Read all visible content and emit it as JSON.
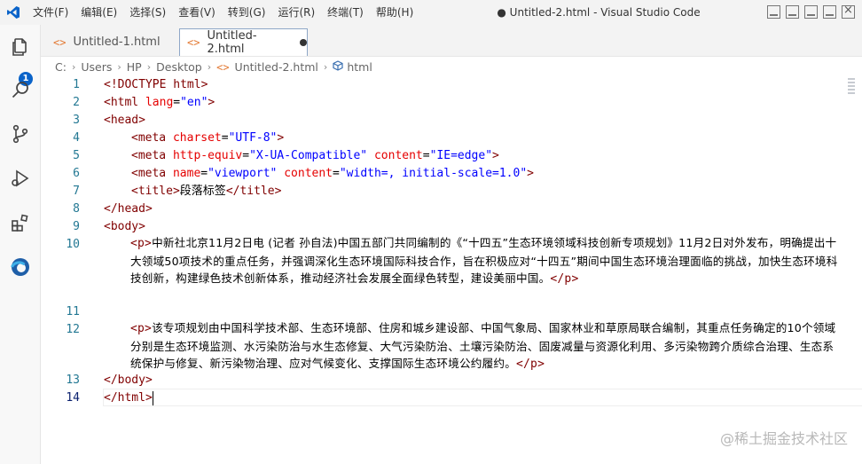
{
  "menu": [
    "文件(F)",
    "编辑(E)",
    "选择(S)",
    "查看(V)",
    "转到(G)",
    "运行(R)",
    "终端(T)",
    "帮助(H)"
  ],
  "window_title": "● Untitled-2.html - Visual Studio Code",
  "activity": {
    "badge": "1"
  },
  "tabs": [
    {
      "label": "Untitled-1.html",
      "icon": "html-icon"
    },
    {
      "label": "Untitled-2.html",
      "icon": "html-icon",
      "dirty": true
    }
  ],
  "breadcrumb": [
    "C:",
    "Users",
    "HP",
    "Desktop",
    "Untitled-2.html",
    "html"
  ],
  "lines": {
    "n1": "1",
    "n2": "2",
    "n3": "3",
    "n4": "4",
    "n5": "5",
    "n6": "6",
    "n7": "7",
    "n8": "8",
    "n9": "9",
    "n10": "10",
    "n11": "11",
    "n12": "12",
    "n13": "13",
    "n14": "14",
    "l1": "<!DOCTYPE html>",
    "l2_open": "<html ",
    "l2_attr": "lang",
    "l2_eq": "=",
    "l2_val": "\"en\"",
    "l2_close": ">",
    "l3": "<head>",
    "l4_open": "<meta ",
    "l4_attr": "charset",
    "l4_eq": "=",
    "l4_val": "\"UTF-8\"",
    "l4_close": ">",
    "l5_open": "<meta ",
    "l5_attr1": "http-equiv",
    "l5_eq1": "=",
    "l5_val1": "\"X-UA-Compatible\"",
    "l5_sp": " ",
    "l5_attr2": "content",
    "l5_eq2": "=",
    "l5_val2": "\"IE=edge\"",
    "l5_close": ">",
    "l6_open": "<meta ",
    "l6_attr1": "name",
    "l6_eq1": "=",
    "l6_val1": "\"viewport\"",
    "l6_sp": " ",
    "l6_attr2": "content",
    "l6_eq2": "=",
    "l6_val2": "\"width=, initial-scale=1.0\"",
    "l6_close": ">",
    "l7_open": "<title>",
    "l7_text": "段落标签",
    "l7_close": "</title>",
    "l8": "</head>",
    "l9": "<body>",
    "l10_open": "<p>",
    "l10_text": "中新社北京11月2日电 (记者 孙自法)中国五部门共同编制的《“十四五”生态环境领域科技创新专项规划》11月2日对外发布，明确提出十大领域50项技术的重点任务，并强调深化生态环境国际科技合作，旨在积极应对“十四五”期间中国生态环境治理面临的挑战，加快生态环境科技创新，构建绿色技术创新体系，推动经济社会发展全面绿色转型，建设美丽中国。",
    "l10_close": "</p>",
    "l12_open": "<p>",
    "l12_text": "该专项规划由中国科学技术部、生态环境部、住房和城乡建设部、中国气象局、国家林业和草原局联合编制，其重点任务确定的10个领域分别是生态环境监测、水污染防治与水生态修复、大气污染防治、土壤污染防治、固废减量与资源化利用、多污染物跨介质综合治理、生态系统保护与修复、新污染物治理、应对气候变化、支撑国际生态环境公约履约。",
    "l12_close": "</p>",
    "l13": "</body>",
    "l14": "</html>"
  },
  "watermark": "@稀土掘金技术社区",
  "colors": {
    "tag": "#800000",
    "attr": "#e50000",
    "value": "#0000ff",
    "line_number": "#237893",
    "badge": "#0a63c9"
  }
}
